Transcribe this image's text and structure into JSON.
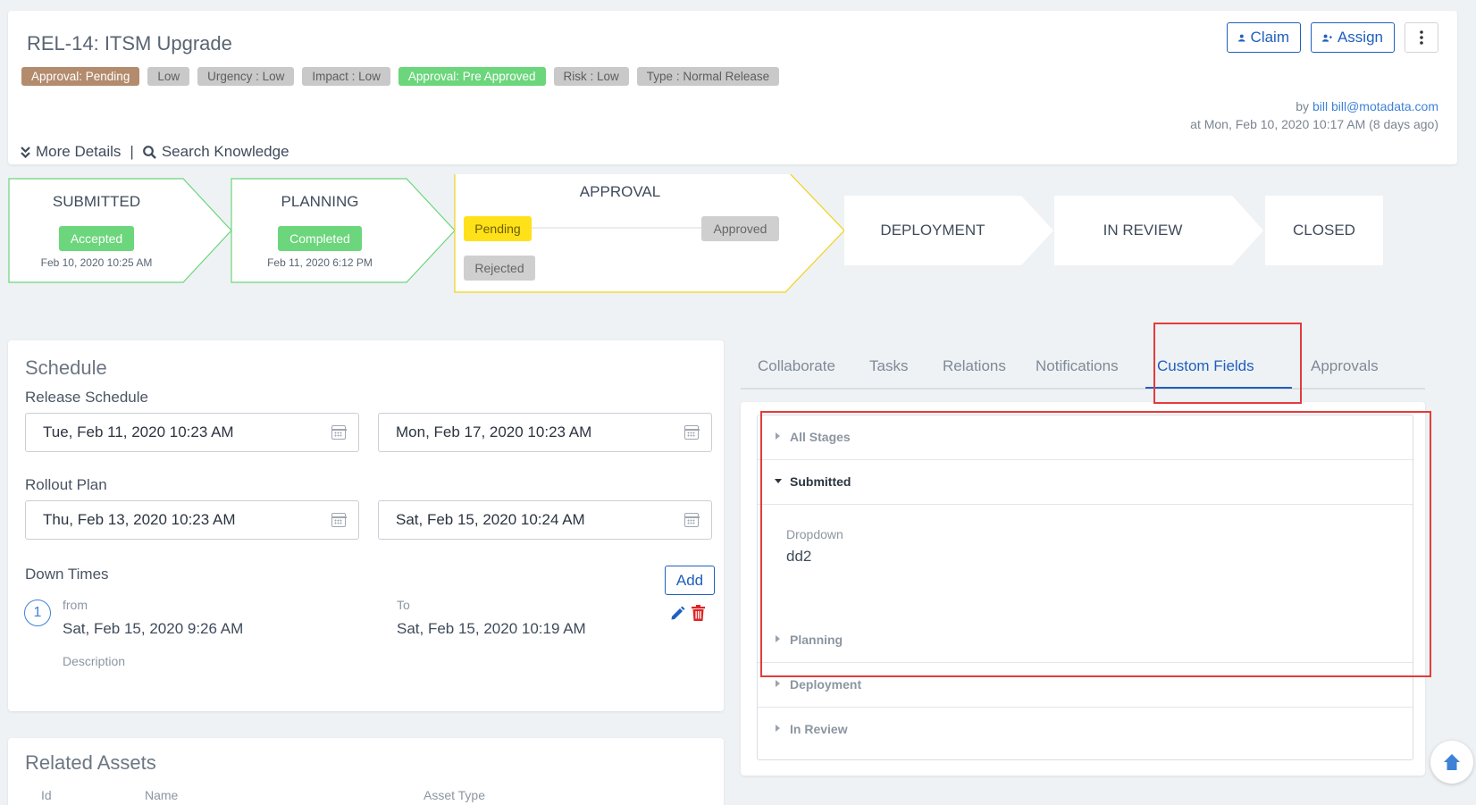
{
  "header": {
    "title": "REL-14: ITSM Upgrade",
    "tags": [
      {
        "label": "Approval: Pending",
        "style": "brown"
      },
      {
        "label": "Low",
        "style": "grey"
      },
      {
        "label": "Urgency : Low",
        "style": "grey"
      },
      {
        "label": "Impact : Low",
        "style": "grey"
      },
      {
        "label": "Approval: Pre Approved",
        "style": "green"
      },
      {
        "label": "Risk : Low",
        "style": "grey"
      },
      {
        "label": "Type : Normal Release",
        "style": "grey"
      }
    ],
    "claim_label": "Claim",
    "assign_label": "Assign",
    "by_prefix": "by",
    "by_user": "bill",
    "by_email": "bill@motadata.com",
    "created_at": "at Mon, Feb 10, 2020 10:17 AM (8 days ago)",
    "more_details_label": "More Details",
    "separator": "|",
    "search_knowledge_label": "Search Knowledge"
  },
  "pipeline": {
    "submitted": {
      "label": "SUBMITTED",
      "badge": "Accepted",
      "date": "Feb 10, 2020 10:25 AM"
    },
    "planning": {
      "label": "PLANNING",
      "badge": "Completed",
      "date": "Feb 11, 2020 6:12 PM"
    },
    "approval": {
      "label": "APPROVAL",
      "pending": "Pending",
      "approved": "Approved",
      "rejected": "Rejected"
    },
    "deployment": {
      "label": "DEPLOYMENT"
    },
    "in_review": {
      "label": "IN REVIEW"
    },
    "closed": {
      "label": "CLOSED"
    }
  },
  "schedule": {
    "title": "Schedule",
    "release_schedule_label": "Release Schedule",
    "release_start": "Tue, Feb 11, 2020 10:23 AM",
    "release_end": "Mon, Feb 17, 2020 10:23 AM",
    "rollout_plan_label": "Rollout Plan",
    "rollout_start": "Thu, Feb 13, 2020 10:23 AM",
    "rollout_end": "Sat, Feb 15, 2020 10:24 AM",
    "down_times_label": "Down Times",
    "add_label": "Add",
    "downtime": {
      "index": "1",
      "from_label": "from",
      "from_value": "Sat, Feb 15, 2020 9:26 AM",
      "to_label": "To",
      "to_value": "Sat, Feb 15, 2020 10:19 AM",
      "description_label": "Description"
    }
  },
  "assets": {
    "title": "Related Assets",
    "columns": [
      "Id",
      "Name",
      "Asset Type"
    ]
  },
  "tabs": [
    "Collaborate",
    "Tasks",
    "Relations",
    "Notifications",
    "Custom Fields",
    "Approvals"
  ],
  "active_tab": "Custom Fields",
  "custom_fields": {
    "sections": [
      "All Stages",
      "Submitted",
      "Planning",
      "Deployment",
      "In Review"
    ],
    "open_section": "Submitted",
    "field_label": "Dropdown",
    "field_value": "dd2"
  },
  "colors": {
    "accent": "#1f5fbd",
    "success": "#6bd67b",
    "pending": "#ffe11a",
    "highlight": "#e43b3b"
  }
}
